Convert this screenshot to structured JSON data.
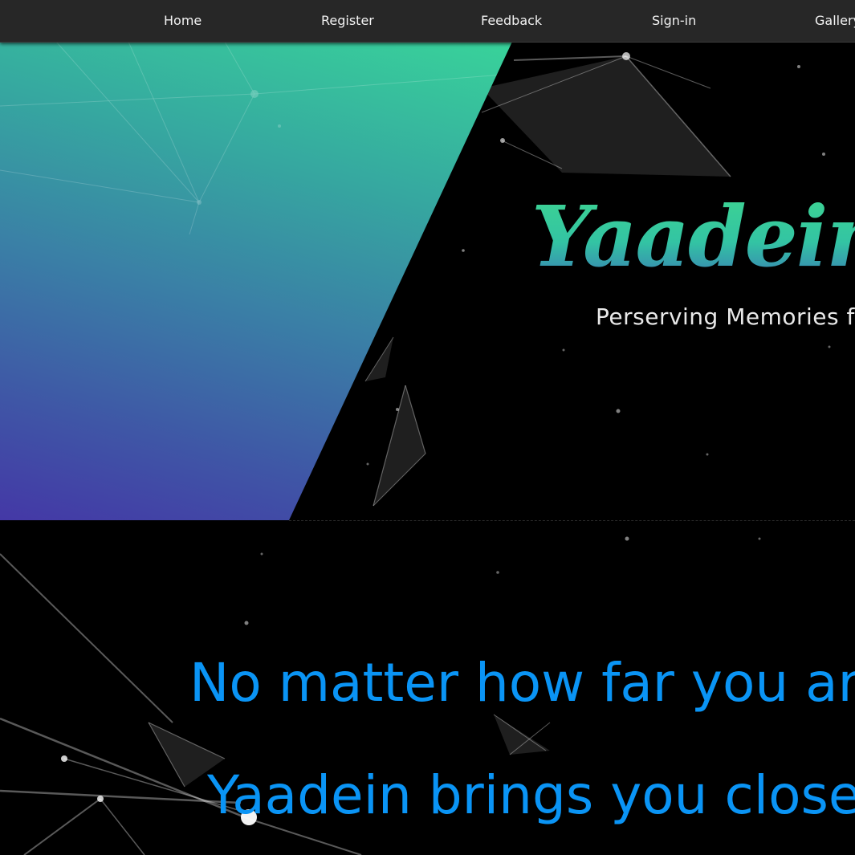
{
  "nav": {
    "items": [
      {
        "label": "Home"
      },
      {
        "label": "Register"
      },
      {
        "label": "Feedback"
      },
      {
        "label": "Sign-in"
      },
      {
        "label": "Gallery"
      }
    ]
  },
  "hero": {
    "logo_title": "Yaadein",
    "logo_subtitle": "Perserving Memories fo",
    "gradient_colors": [
      "#38d39a",
      "#3a7fa6",
      "#4438a6"
    ]
  },
  "tagline": {
    "line1": "No matter how far you ar",
    "line2": "Yaadein brings you close",
    "color": "#0a94f5"
  },
  "colors": {
    "navbar_bg": "#272727",
    "nav_text": "#f2f2f2",
    "page_bg": "#000000"
  }
}
